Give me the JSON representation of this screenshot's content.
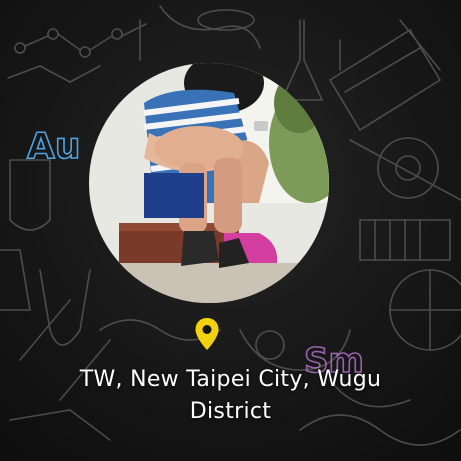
{
  "profile": {
    "location_line1": "TW, New Taipei City, Wugu",
    "location_line2": "District",
    "location_icon": "location-pin-icon"
  },
  "background": {
    "symbols": [
      "Au",
      "Sm"
    ]
  },
  "colors": {
    "pin": "#f2d10f",
    "text": "#ffffff",
    "background": "#151515",
    "au_symbol": "#4ea3e0",
    "sm_symbol": "#b070c8"
  }
}
